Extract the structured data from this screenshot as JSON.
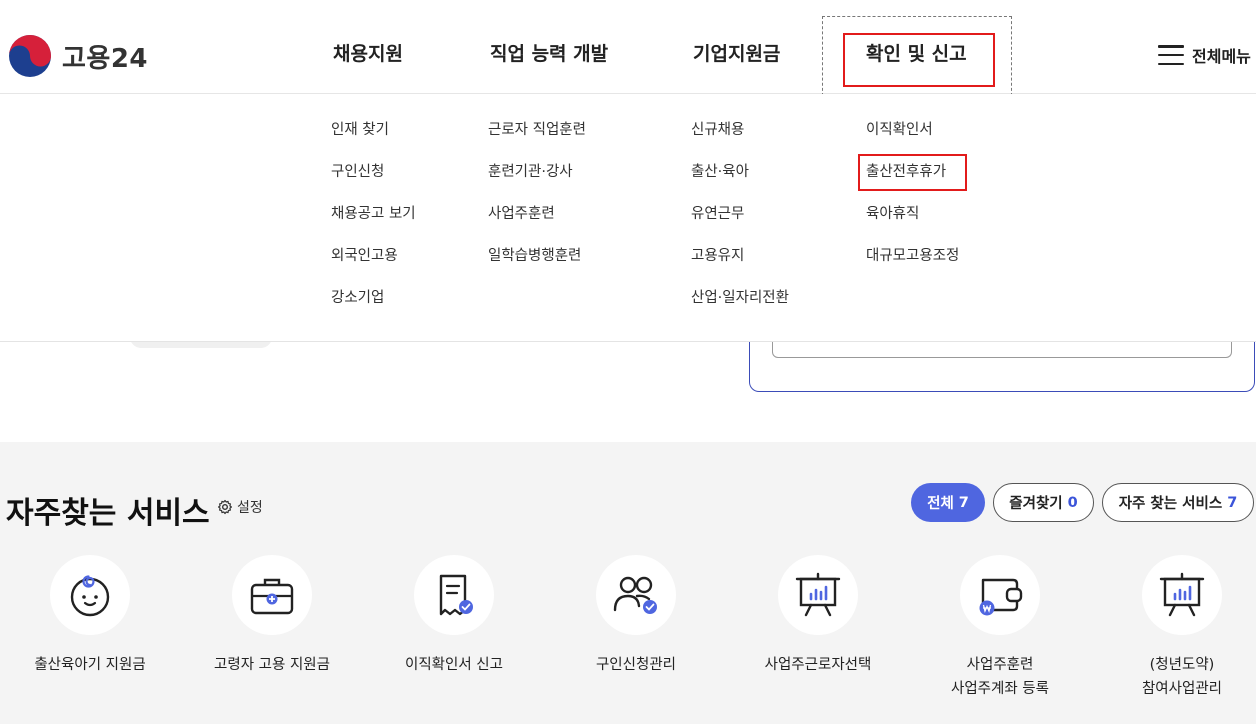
{
  "brand": {
    "name": "고용24"
  },
  "gnb": [
    {
      "label": "채용지원"
    },
    {
      "label": "직업 능력 개발"
    },
    {
      "label": "기업지원금"
    },
    {
      "label": "확인 및 신고"
    }
  ],
  "all_menu": {
    "label": "전체메뉴"
  },
  "submenu": {
    "col1": [
      "인재 찾기",
      "구인신청",
      "채용공고 보기",
      "외국인고용",
      "강소기업"
    ],
    "col2": [
      "근로자 직업훈련",
      "훈련기관·강사",
      "사업주훈련",
      "일학습병행훈련"
    ],
    "col3": [
      "신규채용",
      "출산·육아",
      "유연근무",
      "고용유지",
      "산업·일자리전환"
    ],
    "col4": [
      "이직확인서",
      "출산전후휴가",
      "육아휴직",
      "대규모고용조정"
    ]
  },
  "services": {
    "title": "자주찾는 서비스",
    "settings_label": "설정",
    "filters": [
      {
        "label": "전체",
        "count": "7",
        "active": true
      },
      {
        "label": "즐겨찾기",
        "count": "0",
        "active": false
      },
      {
        "label": "자주 찾는 서비스",
        "count": "7",
        "active": false
      }
    ],
    "items": [
      {
        "line1": "출산육아기 지원금",
        "line2": "",
        "icon": "baby-icon"
      },
      {
        "line1": "고령자 고용 지원금",
        "line2": "",
        "icon": "briefcase-plus-icon"
      },
      {
        "line1": "이직확인서 신고",
        "line2": "",
        "icon": "document-check-icon"
      },
      {
        "line1": "구인신청관리",
        "line2": "",
        "icon": "users-check-icon"
      },
      {
        "line1": "사업주근로자선택",
        "line2": "",
        "icon": "presentation-board-icon"
      },
      {
        "line1": "사업주훈련",
        "line2": "사업주계좌 등록",
        "icon": "wallet-won-icon"
      },
      {
        "line1": "(청년도약)",
        "line2": "참여사업관리",
        "icon": "presentation-board-icon"
      }
    ]
  },
  "colors": {
    "accent": "#4f66e0",
    "highlight": "#e21b1b",
    "section_bg": "#f4f4f4"
  }
}
